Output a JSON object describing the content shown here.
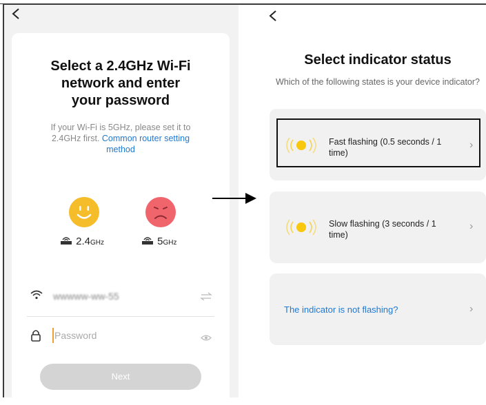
{
  "left": {
    "back_icon": "chevron-left-icon",
    "title_line1": "Select a 2.4GHz Wi-Fi",
    "title_line2": "network and enter",
    "title_line3": "your password",
    "hint_line1": "If your Wi-Fi is 5GHz, please set it to",
    "hint_line2_prefix": "2.4GHz first. ",
    "hint_link_part1": "Common router setting",
    "hint_link_part2": "method",
    "band_good": {
      "label": "2.4",
      "unit": "GHz",
      "face": "happy-face-icon",
      "color": "#f6bd2b"
    },
    "band_bad": {
      "label": "5",
      "unit": "GHz",
      "face": "sad-face-icon",
      "color": "#f0646c"
    },
    "wifi_name": "wwwww-ww-55",
    "password_placeholder": "Password",
    "next_label": "Next"
  },
  "right": {
    "back_icon": "chevron-left-icon",
    "title": "Select indicator status",
    "subtitle": "Which of the following states is your device indicator?",
    "options": [
      {
        "label_line1": "Fast flashing (0.5 seconds / 1",
        "label_line2": "time)"
      },
      {
        "label_line1": "Slow flashing (3 seconds / 1",
        "label_line2": "time)"
      }
    ],
    "not_flashing": "The indicator is not flashing?",
    "chevron": "›",
    "accent_color": "#1f78d1",
    "indicator_color": "#f8c80e"
  }
}
